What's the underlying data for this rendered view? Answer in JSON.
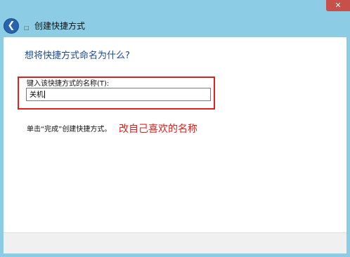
{
  "window": {
    "title": "创建快捷方式",
    "close_glyph": "✕",
    "back_icon": "back-arrow-icon",
    "title_icon": "shortcut-icon"
  },
  "content": {
    "heading": "想将快捷方式命名为什么?",
    "name_label": "键入该快捷方式的名称(T):",
    "name_value": "关机",
    "hint": "单击“完成”创建快捷方式。"
  },
  "annotation": {
    "text": "改自己喜欢的名称",
    "color": "#e02020"
  },
  "colors": {
    "chrome": "#8ccce4",
    "heading": "#1d4a8c",
    "close_button": "#c7504a"
  }
}
